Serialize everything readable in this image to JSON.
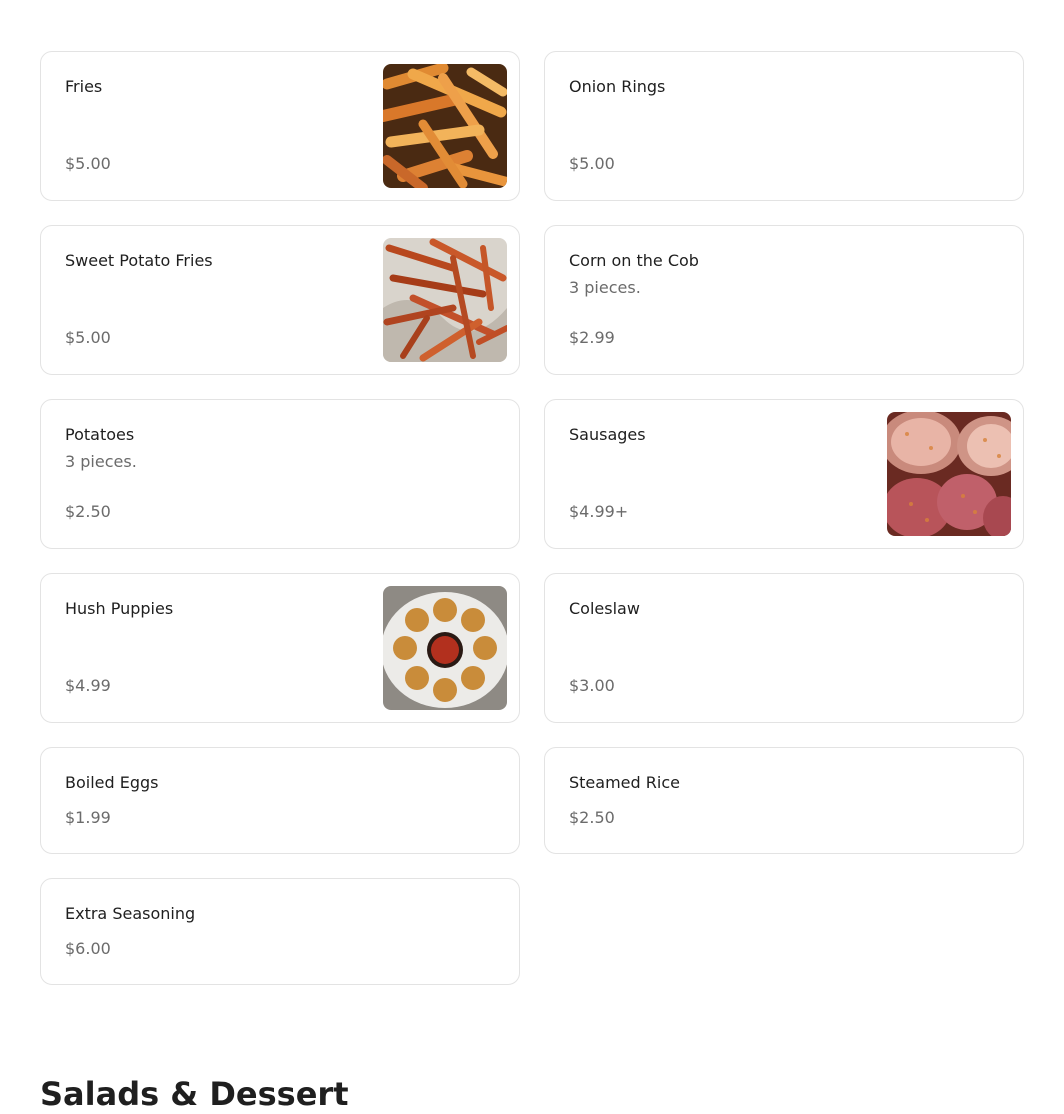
{
  "items": [
    {
      "name": "Fries",
      "description": "",
      "price": "$5.00",
      "image": "fries-photo"
    },
    {
      "name": "Onion Rings",
      "description": "",
      "price": "$5.00",
      "image": ""
    },
    {
      "name": "Sweet Potato Fries",
      "description": "",
      "price": "$5.00",
      "image": "sweet-potato-fries-photo"
    },
    {
      "name": "Corn on the Cob",
      "description": "3 pieces.",
      "price": "$2.99",
      "image": ""
    },
    {
      "name": "Potatoes",
      "description": "3 pieces.",
      "price": "$2.50",
      "image": ""
    },
    {
      "name": "Sausages",
      "description": "",
      "price": "$4.99+",
      "image": "sausages-photo"
    },
    {
      "name": "Hush Puppies",
      "description": "",
      "price": "$4.99",
      "image": "hush-puppies-photo"
    },
    {
      "name": "Coleslaw",
      "description": "",
      "price": "$3.00",
      "image": ""
    },
    {
      "name": "Boiled Eggs",
      "description": "",
      "price": "$1.99",
      "image": ""
    },
    {
      "name": "Steamed Rice",
      "description": "",
      "price": "$2.50",
      "image": ""
    },
    {
      "name": "Extra Seasoning",
      "description": "",
      "price": "$6.00",
      "image": ""
    }
  ],
  "next_section": {
    "title": "Salads & Dessert"
  },
  "colors": {
    "text_primary": "#1f1f1f",
    "text_secondary": "#6b6b6b",
    "card_border": "#e3e3e3"
  }
}
